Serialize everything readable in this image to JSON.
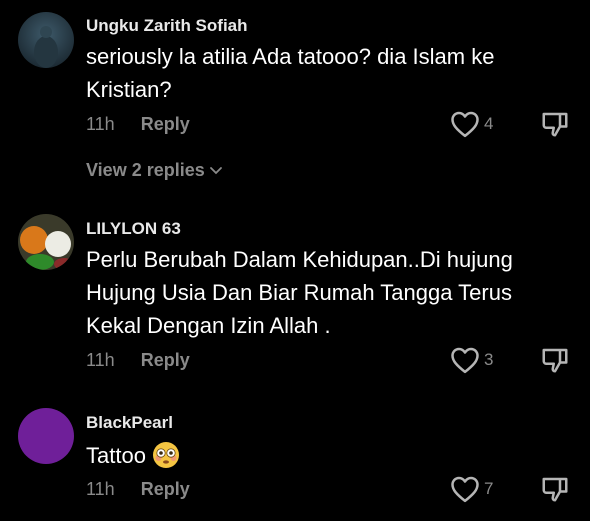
{
  "comments": [
    {
      "username": "Ungku Zarith Sofiah",
      "text": "seriously la atilia Ada tatooo? dia Islam ke Kristian?",
      "time": "11h",
      "reply_label": "Reply",
      "likes": "4",
      "view_replies": "View 2 replies"
    },
    {
      "username": "LILYLON 63",
      "text": "Perlu Berubah Dalam Kehidupan..Di hujung Hujung Usia Dan Biar Rumah Tangga Terus Kekal Dengan Izin Allah .",
      "time": "11h",
      "reply_label": "Reply",
      "likes": "3"
    },
    {
      "username": "BlackPearl",
      "text": "Tattoo",
      "time": "11h",
      "reply_label": "Reply",
      "likes": "7"
    }
  ],
  "colors": {
    "background": "#000000",
    "secondary_text": "#8a8a8a",
    "avatar_blackpearl": "#6f1f99"
  },
  "icons": {
    "like": "heart-outline-icon",
    "dislike": "thumbs-down-icon",
    "expand": "chevron-down-icon",
    "emoji": "flushed-face-emoji"
  }
}
